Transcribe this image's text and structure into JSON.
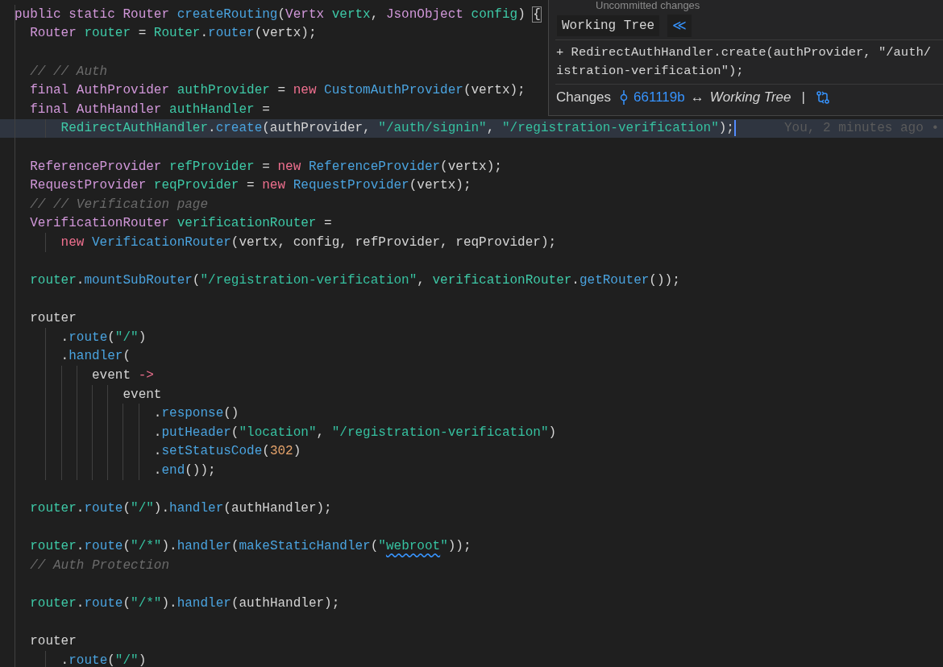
{
  "hover_popup": {
    "heading": "Uncommitted changes",
    "badge": "Working Tree",
    "collapse_button": "≪",
    "diff_lines": [
      "+ RedirectAuthHandler.create(authProvider, \"/auth/",
      "istration-verification\");"
    ],
    "footer": {
      "label": "Changes",
      "commit": "661119b",
      "arrow": "↔",
      "target": "Working Tree",
      "separator": "|"
    }
  },
  "editor": {
    "blocks": [
      {
        "lines": [
          {
            "current": false,
            "tokens": [
              {
                "text": "public static ",
                "kind": "kw"
              },
              {
                "text": "Router ",
                "kind": "type"
              },
              {
                "text": "createRouting",
                "kind": "fn"
              },
              {
                "text": "(",
                "kind": "p"
              },
              {
                "text": "Vertx ",
                "kind": "type"
              },
              {
                "text": "vertx",
                "kind": "var"
              },
              {
                "text": ", ",
                "kind": "p"
              },
              {
                "text": "JsonObject ",
                "kind": "type"
              },
              {
                "text": "config",
                "kind": "var"
              },
              {
                "text": ") ",
                "kind": "p"
              },
              {
                "text": "{",
                "kind": "bracket_match"
              }
            ]
          },
          {
            "current": false,
            "tokens": [
              {
                "text": "  Router ",
                "kind": "type"
              },
              {
                "text": "router",
                "kind": "var"
              },
              {
                "text": " = ",
                "kind": "p"
              },
              {
                "text": "Router",
                "kind": "var"
              },
              {
                "text": ".",
                "kind": "p"
              },
              {
                "text": "router",
                "kind": "fn"
              },
              {
                "text": "(vertx);",
                "kind": "p"
              }
            ]
          }
        ]
      },
      {
        "lines": [
          {
            "current": false,
            "tokens": [
              {
                "text": "  // // Auth",
                "kind": "com"
              }
            ]
          },
          {
            "current": false,
            "tokens": [
              {
                "text": "  final ",
                "kind": "kw"
              },
              {
                "text": "AuthProvider ",
                "kind": "type"
              },
              {
                "text": "authProvider",
                "kind": "var"
              },
              {
                "text": " = ",
                "kind": "p"
              },
              {
                "text": "new ",
                "kind": "new"
              },
              {
                "text": "CustomAuthProvider",
                "kind": "fn"
              },
              {
                "text": "(vertx);",
                "kind": "p"
              }
            ]
          },
          {
            "current": false,
            "tokens": [
              {
                "text": "  final ",
                "kind": "kw"
              },
              {
                "text": "AuthHandler ",
                "kind": "type"
              },
              {
                "text": "authHandler",
                "kind": "var"
              },
              {
                "text": " =",
                "kind": "p"
              }
            ]
          },
          {
            "current": true,
            "blame": "You, 2 minutes ago •",
            "tokens": [
              {
                "text": "      RedirectAuthHandler",
                "kind": "var"
              },
              {
                "text": ".",
                "kind": "p"
              },
              {
                "text": "create",
                "kind": "fn"
              },
              {
                "text": "(authProvider, ",
                "kind": "p"
              },
              {
                "text": "\"/auth/signin\"",
                "kind": "str"
              },
              {
                "text": ", ",
                "kind": "p"
              },
              {
                "text": "\"/registration-verification\"",
                "kind": "str"
              },
              {
                "text": ");",
                "kind": "p"
              }
            ]
          }
        ]
      },
      {
        "lines": [
          {
            "current": false,
            "tokens": [
              {
                "text": "  ReferenceProvider ",
                "kind": "type"
              },
              {
                "text": "refProvider",
                "kind": "var"
              },
              {
                "text": " = ",
                "kind": "p"
              },
              {
                "text": "new ",
                "kind": "new"
              },
              {
                "text": "ReferenceProvider",
                "kind": "fn"
              },
              {
                "text": "(vertx);",
                "kind": "p"
              }
            ]
          },
          {
            "current": false,
            "tokens": [
              {
                "text": "  RequestProvider ",
                "kind": "type"
              },
              {
                "text": "reqProvider",
                "kind": "var"
              },
              {
                "text": " = ",
                "kind": "p"
              },
              {
                "text": "new ",
                "kind": "new"
              },
              {
                "text": "RequestProvider",
                "kind": "fn"
              },
              {
                "text": "(vertx);",
                "kind": "p"
              }
            ]
          },
          {
            "current": false,
            "tokens": [
              {
                "text": "  // // Verification page",
                "kind": "com"
              }
            ]
          },
          {
            "current": false,
            "tokens": [
              {
                "text": "  VerificationRouter ",
                "kind": "type"
              },
              {
                "text": "verificationRouter",
                "kind": "var"
              },
              {
                "text": " =",
                "kind": "p"
              }
            ]
          },
          {
            "current": false,
            "tokens": [
              {
                "text": "      new ",
                "kind": "new"
              },
              {
                "text": "VerificationRouter",
                "kind": "fn"
              },
              {
                "text": "(vertx, config, refProvider, reqProvider);",
                "kind": "p"
              }
            ]
          }
        ]
      },
      {
        "lines": [
          {
            "current": false,
            "tokens": [
              {
                "text": "  router",
                "kind": "var"
              },
              {
                "text": ".",
                "kind": "p"
              },
              {
                "text": "mountSubRouter",
                "kind": "fn"
              },
              {
                "text": "(",
                "kind": "p"
              },
              {
                "text": "\"/registration-verification\"",
                "kind": "str"
              },
              {
                "text": ", ",
                "kind": "p"
              },
              {
                "text": "verificationRouter",
                "kind": "var"
              },
              {
                "text": ".",
                "kind": "p"
              },
              {
                "text": "getRouter",
                "kind": "fn"
              },
              {
                "text": "());",
                "kind": "p"
              }
            ]
          }
        ]
      },
      {
        "lines": [
          {
            "current": false,
            "tokens": [
              {
                "text": "  router",
                "kind": "p"
              }
            ]
          },
          {
            "current": false,
            "tokens": [
              {
                "text": "      .",
                "kind": "p"
              },
              {
                "text": "route",
                "kind": "fn"
              },
              {
                "text": "(",
                "kind": "p"
              },
              {
                "text": "\"/\"",
                "kind": "str"
              },
              {
                "text": ")",
                "kind": "p"
              }
            ]
          },
          {
            "current": false,
            "tokens": [
              {
                "text": "      .",
                "kind": "p"
              },
              {
                "text": "handler",
                "kind": "fn"
              },
              {
                "text": "(",
                "kind": "p"
              }
            ]
          },
          {
            "current": false,
            "tokens": [
              {
                "text": "          event ",
                "kind": "p"
              },
              {
                "text": "->",
                "kind": "new"
              }
            ]
          },
          {
            "current": false,
            "tokens": [
              {
                "text": "              event",
                "kind": "p"
              }
            ]
          },
          {
            "current": false,
            "tokens": [
              {
                "text": "                  .",
                "kind": "p"
              },
              {
                "text": "response",
                "kind": "fn"
              },
              {
                "text": "()",
                "kind": "p"
              }
            ]
          },
          {
            "current": false,
            "tokens": [
              {
                "text": "                  .",
                "kind": "p"
              },
              {
                "text": "putHeader",
                "kind": "fn"
              },
              {
                "text": "(",
                "kind": "p"
              },
              {
                "text": "\"location\"",
                "kind": "str"
              },
              {
                "text": ", ",
                "kind": "p"
              },
              {
                "text": "\"/registration-verification\"",
                "kind": "str"
              },
              {
                "text": ")",
                "kind": "p"
              }
            ]
          },
          {
            "current": false,
            "tokens": [
              {
                "text": "                  .",
                "kind": "p"
              },
              {
                "text": "setStatusCode",
                "kind": "fn"
              },
              {
                "text": "(",
                "kind": "p"
              },
              {
                "text": "302",
                "kind": "num"
              },
              {
                "text": ")",
                "kind": "p"
              }
            ]
          },
          {
            "current": false,
            "tokens": [
              {
                "text": "                  .",
                "kind": "p"
              },
              {
                "text": "end",
                "kind": "fn"
              },
              {
                "text": "());",
                "kind": "p"
              }
            ]
          }
        ]
      },
      {
        "lines": [
          {
            "current": false,
            "tokens": [
              {
                "text": "  router",
                "kind": "var"
              },
              {
                "text": ".",
                "kind": "p"
              },
              {
                "text": "route",
                "kind": "fn"
              },
              {
                "text": "(",
                "kind": "p"
              },
              {
                "text": "\"/\"",
                "kind": "str"
              },
              {
                "text": ").",
                "kind": "p"
              },
              {
                "text": "handler",
                "kind": "fn"
              },
              {
                "text": "(authHandler);",
                "kind": "p"
              }
            ]
          }
        ]
      },
      {
        "lines": [
          {
            "current": false,
            "tokens": [
              {
                "text": "  router",
                "kind": "var"
              },
              {
                "text": ".",
                "kind": "p"
              },
              {
                "text": "route",
                "kind": "fn"
              },
              {
                "text": "(",
                "kind": "p"
              },
              {
                "text": "\"/*\"",
                "kind": "str"
              },
              {
                "text": ").",
                "kind": "p"
              },
              {
                "text": "handler",
                "kind": "fn"
              },
              {
                "text": "(",
                "kind": "p"
              },
              {
                "text": "makeStaticHandler",
                "kind": "fn"
              },
              {
                "text": "(",
                "kind": "p"
              },
              {
                "text": "\"",
                "kind": "str"
              },
              {
                "text": "webroot",
                "kind": "str_squiggle"
              },
              {
                "text": "\"",
                "kind": "str"
              },
              {
                "text": "));",
                "kind": "p"
              }
            ]
          },
          {
            "current": false,
            "tokens": [
              {
                "text": "  // Auth Protection",
                "kind": "com"
              }
            ]
          }
        ]
      },
      {
        "lines": [
          {
            "current": false,
            "tokens": [
              {
                "text": "  router",
                "kind": "var"
              },
              {
                "text": ".",
                "kind": "p"
              },
              {
                "text": "route",
                "kind": "fn"
              },
              {
                "text": "(",
                "kind": "p"
              },
              {
                "text": "\"/*\"",
                "kind": "str"
              },
              {
                "text": ").",
                "kind": "p"
              },
              {
                "text": "handler",
                "kind": "fn"
              },
              {
                "text": "(authHandler);",
                "kind": "p"
              }
            ]
          }
        ]
      },
      {
        "lines": [
          {
            "current": false,
            "tokens": [
              {
                "text": "  router",
                "kind": "p"
              }
            ]
          },
          {
            "current": false,
            "tokens": [
              {
                "text": "      .",
                "kind": "p"
              },
              {
                "text": "route",
                "kind": "fn"
              },
              {
                "text": "(",
                "kind": "p"
              },
              {
                "text": "\"/\"",
                "kind": "str"
              },
              {
                "text": ")",
                "kind": "p"
              }
            ]
          }
        ]
      }
    ]
  }
}
